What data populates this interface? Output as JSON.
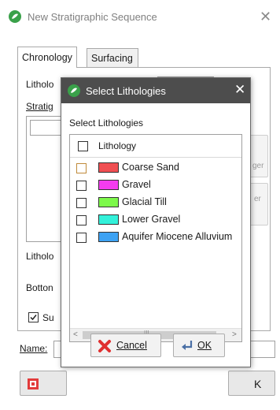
{
  "window": {
    "title": "New Stratigraphic Sequence",
    "close": "✕"
  },
  "tabs": [
    {
      "label": "Chronology",
      "active": true
    },
    {
      "label": "Surfacing",
      "active": false
    }
  ],
  "form": {
    "lithology_label": "Litholo",
    "stratigraphy_label": "Stratig",
    "lithology2_label": "Litholo",
    "bottom_label": "Botton",
    "checkbox_label": "Su",
    "name_label": "Name:",
    "right_btn1_text": "ger",
    "right_btn2_text": "er",
    "bottom_right_text": "K"
  },
  "dialog": {
    "title": "Select Lithologies",
    "close": "✕",
    "section_label": "Select Lithologies",
    "column_header": "Lithology",
    "items": [
      {
        "label": "Coarse Sand",
        "color": "#f04f52",
        "focused": true
      },
      {
        "label": "Gravel",
        "color": "#f43cef",
        "focused": false
      },
      {
        "label": "Glacial Till",
        "color": "#7df94a",
        "focused": false
      },
      {
        "label": "Lower Gravel",
        "color": "#33f1da",
        "focused": false
      },
      {
        "label": "Aquifer Miocene Alluvium",
        "color": "#3da2f3",
        "focused": false
      }
    ],
    "scroll_mark": "III",
    "cancel_label": "Cancel",
    "ok_label": "OK"
  }
}
